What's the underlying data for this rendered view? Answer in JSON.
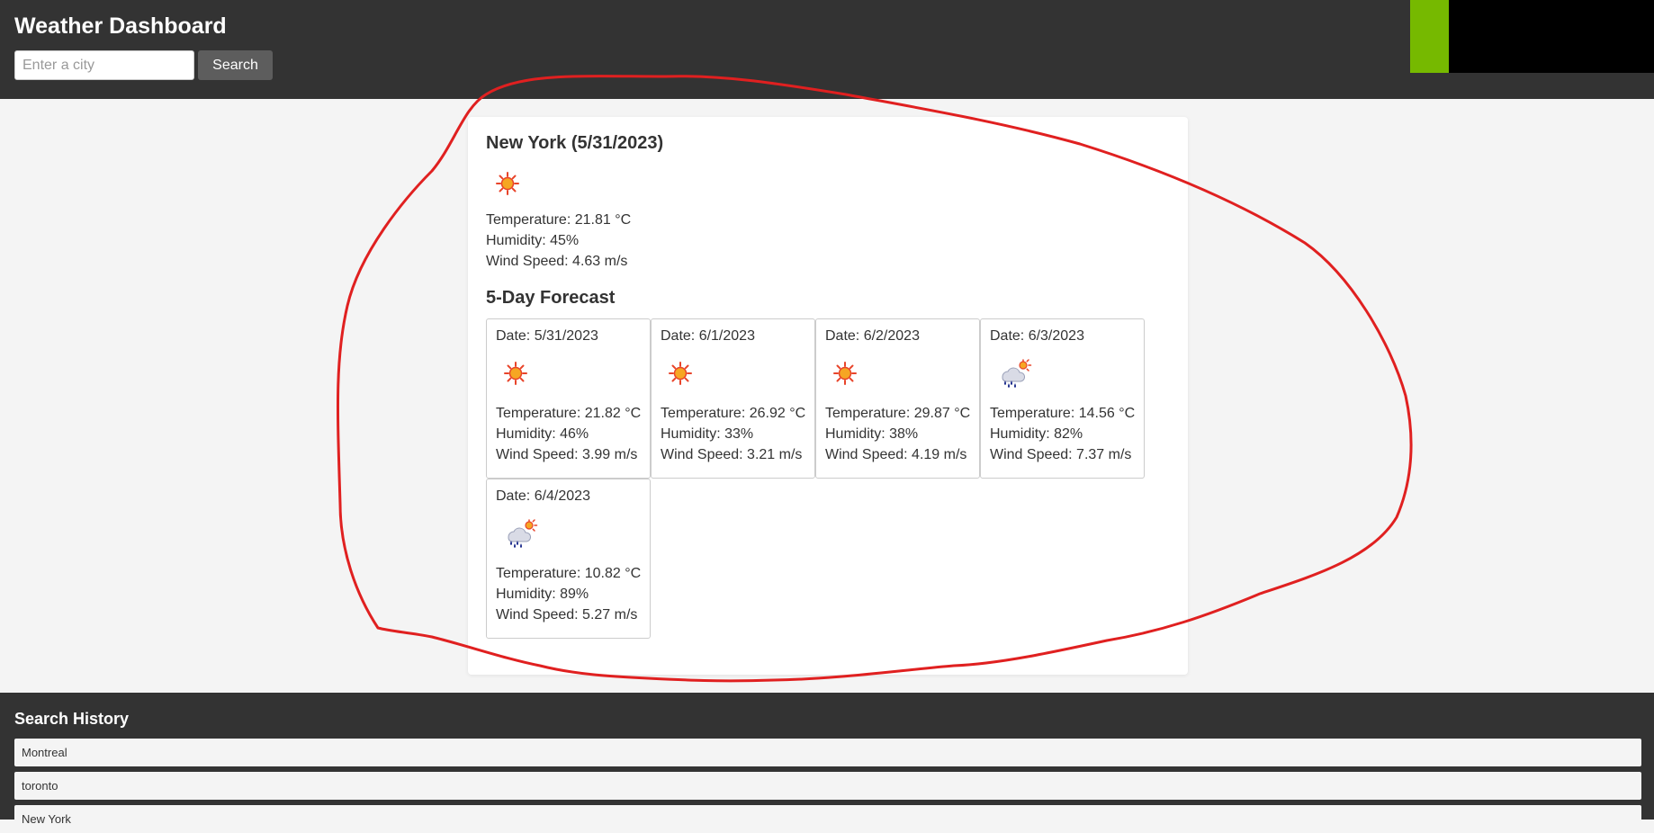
{
  "header": {
    "title": "Weather Dashboard",
    "search_placeholder": "Enter a city",
    "search_value": "",
    "search_label": "Search"
  },
  "current": {
    "title": "New York (5/31/2023)",
    "icon": "sun-icon",
    "temperature": "Temperature: 21.81 °C",
    "humidity": "Humidity: 45%",
    "wind": "Wind Speed: 4.63 m/s"
  },
  "forecast": {
    "title": "5-Day Forecast",
    "days": [
      {
        "date": "Date: 5/31/2023",
        "icon": "sun-icon",
        "temperature": "Temperature: 21.82 °C",
        "humidity": "Humidity: 46%",
        "wind": "Wind Speed: 3.99 m/s"
      },
      {
        "date": "Date: 6/1/2023",
        "icon": "sun-icon",
        "temperature": "Temperature: 26.92 °C",
        "humidity": "Humidity: 33%",
        "wind": "Wind Speed: 3.21 m/s"
      },
      {
        "date": "Date: 6/2/2023",
        "icon": "sun-icon",
        "temperature": "Temperature: 29.87 °C",
        "humidity": "Humidity: 38%",
        "wind": "Wind Speed: 4.19 m/s"
      },
      {
        "date": "Date: 6/3/2023",
        "icon": "rain-cloud-sun-icon",
        "temperature": "Temperature: 14.56 °C",
        "humidity": "Humidity: 82%",
        "wind": "Wind Speed: 7.37 m/s"
      },
      {
        "date": "Date: 6/4/2023",
        "icon": "rain-cloud-sun-icon",
        "temperature": "Temperature: 10.82 °C",
        "humidity": "Humidity: 89%",
        "wind": "Wind Speed: 5.27 m/s"
      }
    ]
  },
  "history": {
    "title": "Search History",
    "items": [
      "Montreal",
      "toronto",
      "New York"
    ]
  },
  "colors": {
    "header_bg": "#333333",
    "page_bg": "#f4f4f4",
    "button_bg": "#5d5d5d",
    "accent_green": "#76b900",
    "annotation_red": "#e02020"
  }
}
